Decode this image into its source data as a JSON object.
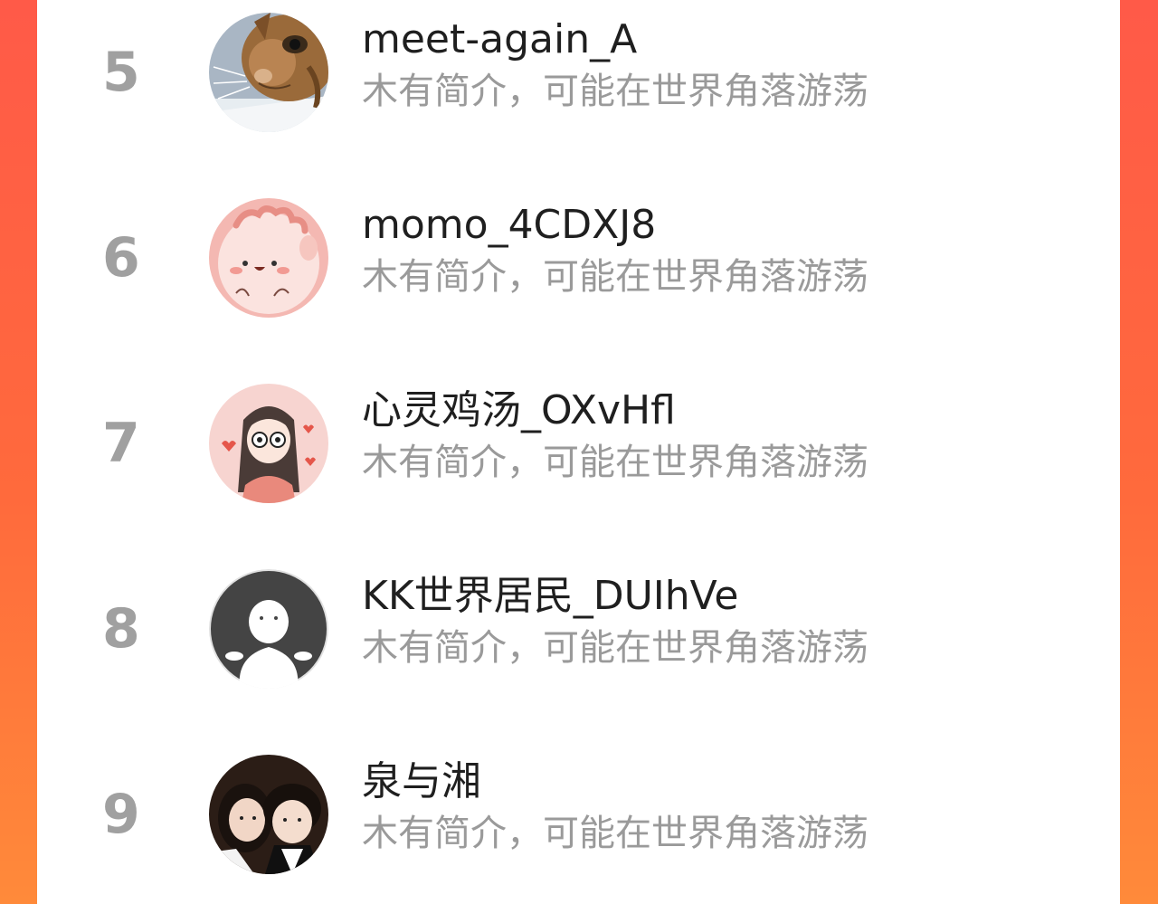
{
  "colors": {
    "accent_gradient_start": "#ff5a48",
    "accent_gradient_end": "#ff8a3a",
    "card_background": "#ffffff",
    "rank_color": "#a0a0a0",
    "name_color": "#1f1f1f",
    "bio_color": "#9a9a9a"
  },
  "ranking": {
    "items": [
      {
        "rank": "5",
        "name": "meet-again_A",
        "bio": "木有简介，可能在世界角落游荡",
        "avatar": "cat-avatar-icon"
      },
      {
        "rank": "6",
        "name": "momo_4CDXJ8",
        "bio": "木有简介，可能在世界角落游荡",
        "avatar": "pink-cartoon-avatar-icon"
      },
      {
        "rank": "7",
        "name": "心灵鸡汤_OXvHfl",
        "bio": "木有简介，可能在世界角落游荡",
        "avatar": "girl-cartoon-avatar-icon"
      },
      {
        "rank": "8",
        "name": "KK世界居民_DUIhVe",
        "bio": "木有简介，可能在世界角落游荡",
        "avatar": "default-person-avatar-icon"
      },
      {
        "rank": "9",
        "name": "泉与湘",
        "bio": "木有简介，可能在世界角落游荡",
        "avatar": "couple-photo-avatar-icon"
      }
    ]
  }
}
